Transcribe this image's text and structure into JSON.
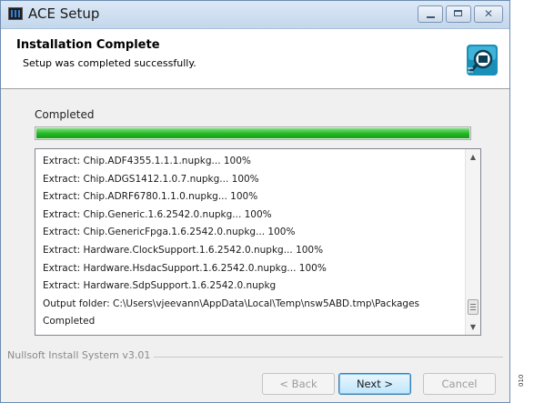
{
  "window": {
    "title": "ACE Setup",
    "minimize_icon": "minimize-icon",
    "maximize_icon": "maximize-icon",
    "close_symbol": "✕"
  },
  "header": {
    "title": "Installation Complete",
    "subtitle": "Setup was completed successfully.",
    "logo_icon": "ace-logo-icon"
  },
  "body": {
    "status_label": "Completed",
    "progress_fraction": 1.0,
    "progress_color": "#22b522",
    "log_lines": [
      "Extract: Chip.ADF4355.1.1.1.nupkg... 100%",
      "Extract: Chip.ADGS1412.1.0.7.nupkg... 100%",
      "Extract: Chip.ADRF6780.1.1.0.nupkg... 100%",
      "Extract: Chip.Generic.1.6.2542.0.nupkg... 100%",
      "Extract: Chip.GenericFpga.1.6.2542.0.nupkg... 100%",
      "Extract: Hardware.ClockSupport.1.6.2542.0.nupkg... 100%",
      "Extract: Hardware.HsdacSupport.1.6.2542.0.nupkg... 100%",
      "Extract: Hardware.SdpSupport.1.6.2542.0.nupkg",
      "Output folder: C:\\Users\\vjeevann\\AppData\\Local\\Temp\\nsw5ABD.tmp\\Packages",
      "Completed"
    ],
    "scroll_up_symbol": "▲",
    "scroll_down_symbol": "▼"
  },
  "footer": {
    "branding": "Nullsoft Install System v3.01",
    "back_label": "< Back",
    "next_label": "Next >",
    "cancel_label": "Cancel"
  },
  "side_code": "010"
}
